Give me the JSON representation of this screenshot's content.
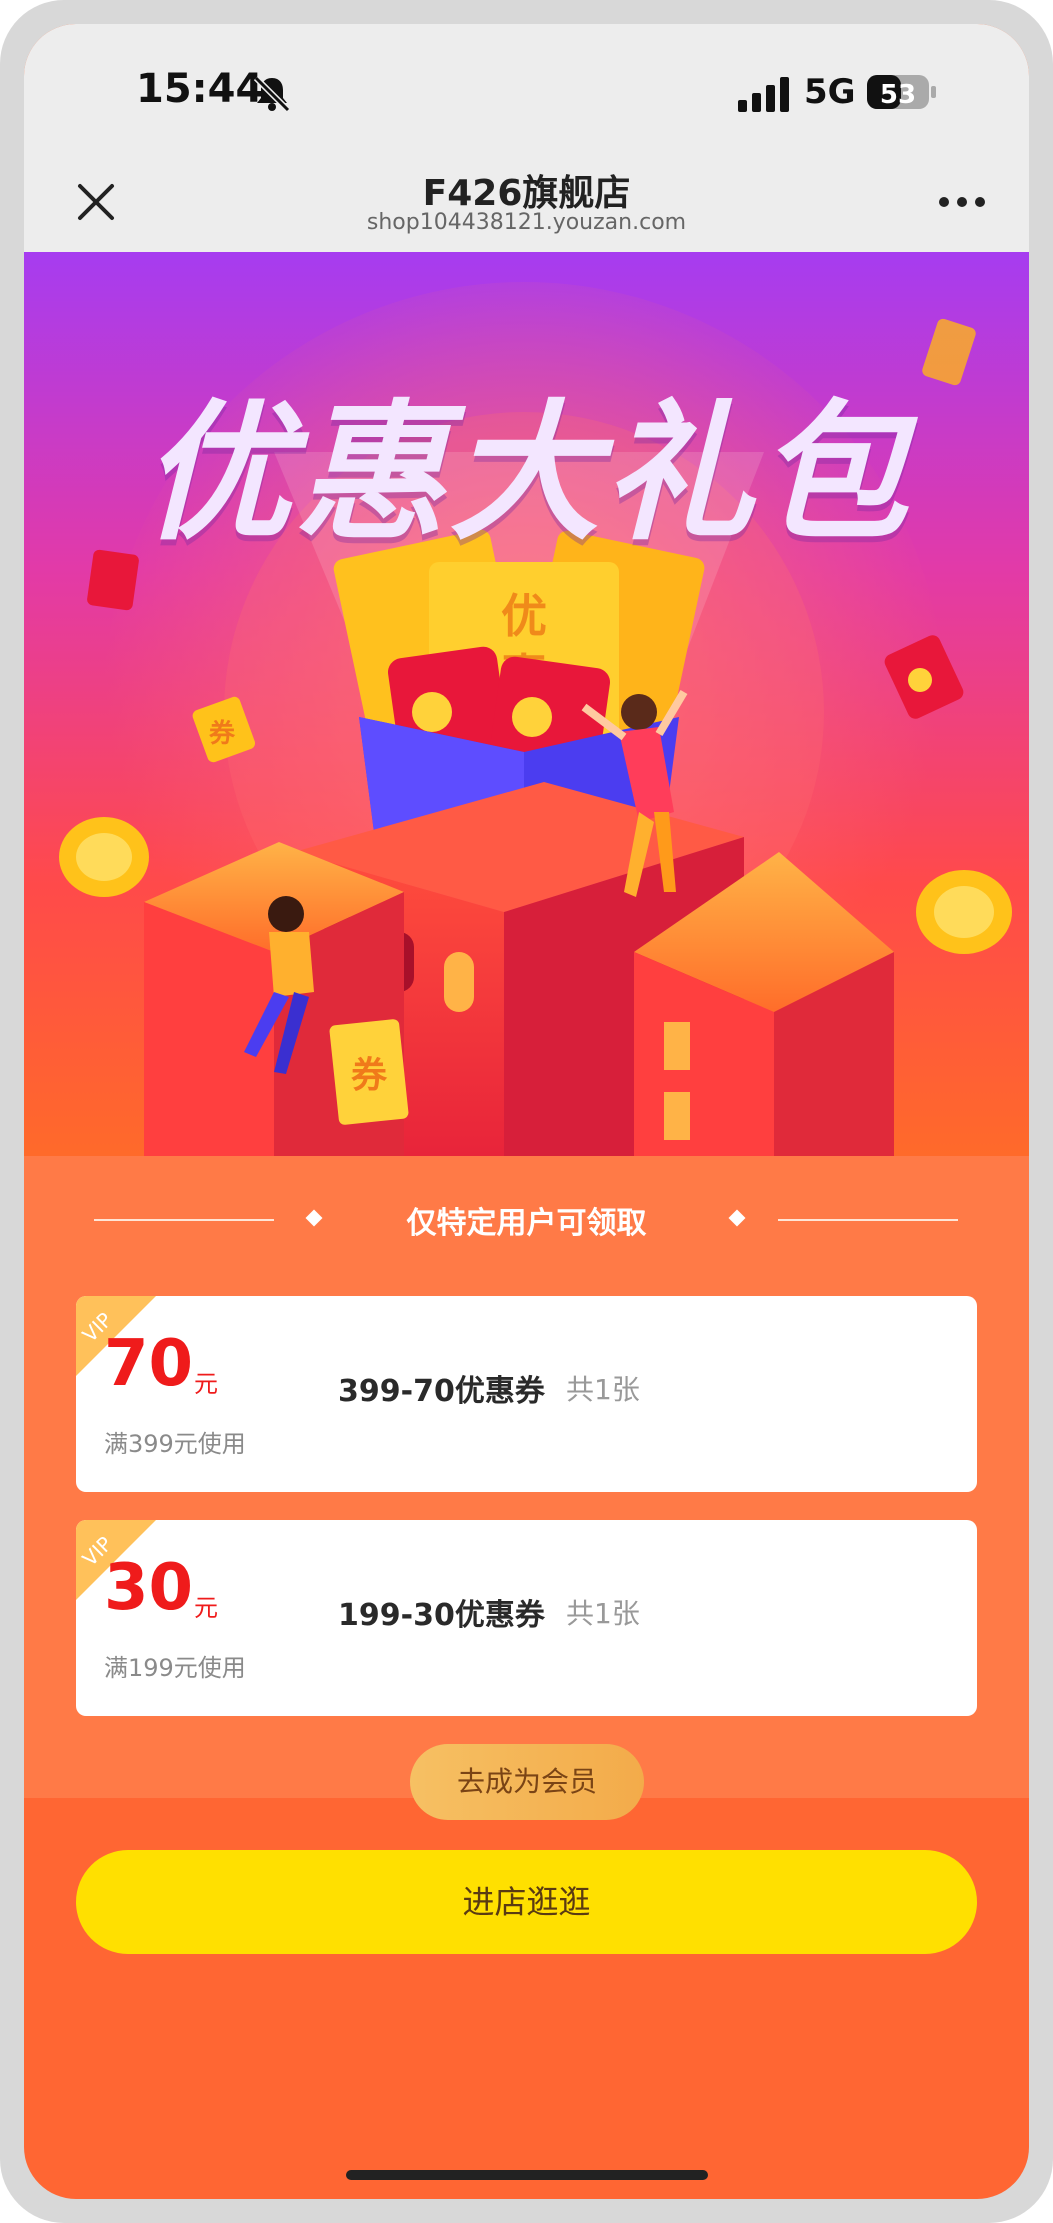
{
  "status_bar": {
    "time": "15:44",
    "network": "5G",
    "battery": "53",
    "icons": [
      "bell-muted-icon",
      "signal-icon",
      "battery-icon"
    ]
  },
  "nav": {
    "title": "F426旗舰店",
    "subtitle": "shop104438121.youzan.com",
    "icons": [
      "close-icon",
      "more-icon"
    ]
  },
  "banner": {
    "title": "优惠大礼包",
    "illustration_text": [
      "优",
      "惠",
      "券",
      "券"
    ]
  },
  "coupons": {
    "notice": "仅特定用户可领取",
    "vip_badge": "VIP",
    "items": [
      {
        "amount": "70",
        "unit": "元",
        "condition": "满399元使用",
        "name": "399-70优惠券",
        "count": "共1张"
      },
      {
        "amount": "30",
        "unit": "元",
        "condition": "满199元使用",
        "name": "199-30优惠券",
        "count": "共1张"
      }
    ],
    "member_button": "去成为会员"
  },
  "shop_button": "进店逛逛",
  "colors": {
    "page_bg": "#ff6633",
    "coupon_area_bg": "#ff7a47",
    "amount_red": "#ef1b1b",
    "shop_button_yellow": "#ffe000",
    "member_button_gold": "#f6c063"
  }
}
